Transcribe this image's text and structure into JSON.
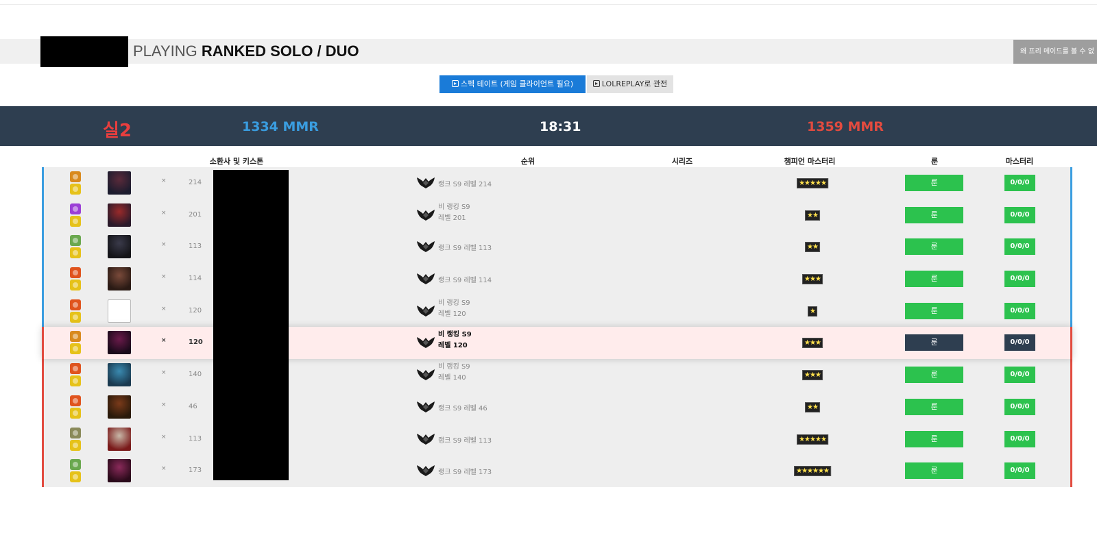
{
  "title": {
    "prefix": "PLAYING",
    "mode": "RANKED SOLO / DUO"
  },
  "why_button": "왜 프리 메이드를 볼 수 없",
  "buttons": {
    "spectate": "스펙 테이트 (게임 클라이언트 필요)",
    "replay": "LOLREPLAY로 관전"
  },
  "header": {
    "tier": "실2",
    "blue_mmr": "1334 MMR",
    "time": "18:31",
    "red_mmr": "1359 MMR"
  },
  "columns": {
    "summoner": "소환사 및 키스톤",
    "rank": "순위",
    "series": "시리즈",
    "mastery": "챔피언 마스터리",
    "runes": "룬",
    "masteries": "마스터리"
  },
  "colors": {
    "blue_team": "#3a9de0",
    "red_team": "#e24b3f",
    "accent_green": "#2cc24e",
    "dark_navy": "#2e3e50"
  },
  "players": [
    {
      "team": "blue",
      "spell1": "#d98a1e",
      "spell2": "#e6c21a",
      "champ": [
        "#5a2a3a",
        "#1c1c2e"
      ],
      "x": "×",
      "level": "214",
      "rank_line1": "랭크 S9 레벨 214",
      "rank_line2": "",
      "mastery": "★★★★★",
      "rune": "룬",
      "masteries": "0/0/0",
      "highlight": false
    },
    {
      "team": "blue",
      "spell1": "#9b3fd6",
      "spell2": "#e6c21a",
      "champ": [
        "#9a2a2a",
        "#2a1a2a"
      ],
      "x": "×",
      "level": "201",
      "rank_line1": "비 랭킹 S9",
      "rank_line2": "레벨 201",
      "mastery": "★★",
      "rune": "룬",
      "masteries": "0/0/0",
      "highlight": false
    },
    {
      "team": "blue",
      "spell1": "#6aa84f",
      "spell2": "#e6c21a",
      "champ": [
        "#3a3a4a",
        "#141418"
      ],
      "x": "×",
      "level": "113",
      "rank_line1": "랭크 S9 레벨 113",
      "rank_line2": "",
      "mastery": "★★",
      "rune": "룬",
      "masteries": "0/0/0",
      "highlight": false
    },
    {
      "team": "blue",
      "spell1": "#e0541e",
      "spell2": "#e6c21a",
      "champ": [
        "#7a4a3a",
        "#2a1a14"
      ],
      "x": "×",
      "level": "114",
      "rank_line1": "랭크 S9 레벨 114",
      "rank_line2": "",
      "mastery": "★★★",
      "rune": "룬",
      "masteries": "0/0/0",
      "highlight": false
    },
    {
      "team": "blue",
      "spell1": "#e0541e",
      "spell2": "#e6c21a",
      "champ": null,
      "x": "×",
      "level": "120",
      "rank_line1": "비 랭킹 S9",
      "rank_line2": "레벨 120",
      "mastery": "★",
      "rune": "룬",
      "masteries": "0/0/0",
      "highlight": false
    },
    {
      "team": "red",
      "spell1": "#d98a1e",
      "spell2": "#e6c21a",
      "champ": [
        "#6a1a4a",
        "#1a0a1a"
      ],
      "x": "×",
      "level": "120",
      "rank_line1": "비 랭킹 S9",
      "rank_line2": "레벨 120",
      "mastery": "★★★",
      "rune": "룬",
      "masteries": "0/0/0",
      "highlight": true
    },
    {
      "team": "red",
      "spell1": "#e0541e",
      "spell2": "#e6c21a",
      "champ": [
        "#3a8ab0",
        "#1a3a50"
      ],
      "x": "×",
      "level": "140",
      "rank_line1": "비 랭킹 S9",
      "rank_line2": "레벨 140",
      "mastery": "★★★",
      "rune": "룬",
      "masteries": "0/0/0",
      "highlight": false
    },
    {
      "team": "red",
      "spell1": "#e0541e",
      "spell2": "#e6c21a",
      "champ": [
        "#7a3a1a",
        "#2a1a0a"
      ],
      "x": "×",
      "level": "46",
      "rank_line1": "랭크 S9 레벨 46",
      "rank_line2": "",
      "mastery": "★★",
      "rune": "룬",
      "masteries": "0/0/0",
      "highlight": false
    },
    {
      "team": "red",
      "spell1": "#8a8a5a",
      "spell2": "#e6c21a",
      "champ": [
        "#c8b8a8",
        "#7a1a1a"
      ],
      "x": "×",
      "level": "113",
      "rank_line1": "랭크 S9 레벨 113",
      "rank_line2": "",
      "mastery": "★★★★★",
      "rune": "룬",
      "masteries": "0/0/0",
      "highlight": false
    },
    {
      "team": "red",
      "spell1": "#6aa84f",
      "spell2": "#e6c21a",
      "champ": [
        "#8a2a5a",
        "#2a0a1a"
      ],
      "x": "×",
      "level": "173",
      "rank_line1": "랭크 S9 레벨 173",
      "rank_line2": "",
      "mastery": "★★★★★★",
      "rune": "룬",
      "masteries": "0/0/0",
      "highlight": false
    }
  ]
}
